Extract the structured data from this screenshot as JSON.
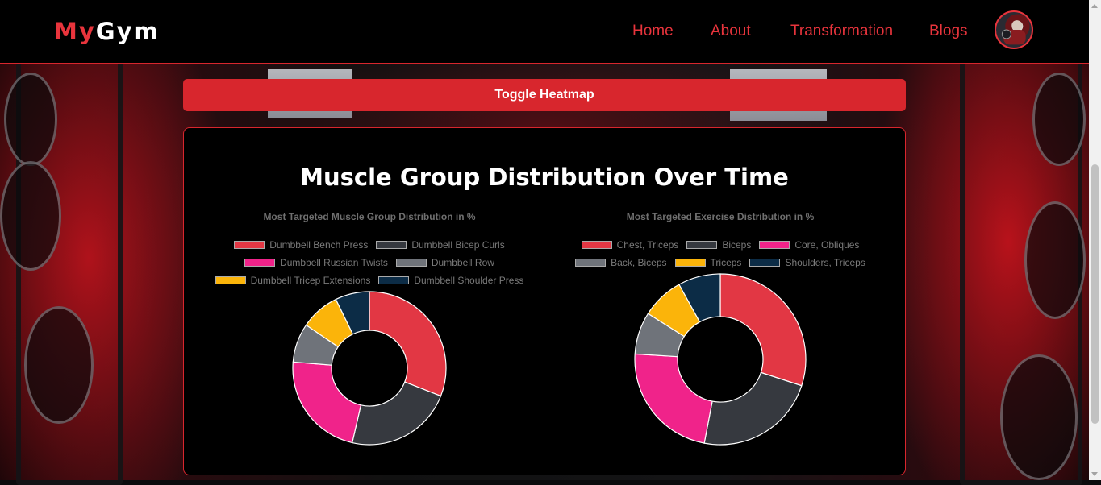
{
  "header": {
    "logo_my": "My",
    "logo_gym": "Gym",
    "nav": [
      "Home",
      "About",
      "Transformation",
      "Blogs"
    ]
  },
  "toggle_label": "Toggle Heatmap",
  "panel_title": "Muscle Group Distribution Over Time",
  "colors": [
    "#e23744",
    "#36393f",
    "#f0238a",
    "#6f737a",
    "#fbb40a",
    "#0c2c46"
  ],
  "chart_data": [
    {
      "type": "donut",
      "title": "Most Targeted Muscle Group Distribution in %",
      "labels": [
        "Dumbbell Bench Press",
        "Dumbbell Bicep Curls",
        "Dumbbell Russian Twists",
        "Dumbbell Row",
        "Dumbbell Tricep Extensions",
        "Dumbbell Shoulder Press"
      ],
      "legend_rows": [
        [
          0,
          1
        ],
        [
          2,
          3
        ],
        [
          4,
          5
        ]
      ],
      "values": [
        30,
        22,
        22,
        8,
        8,
        7
      ],
      "legend": "top"
    },
    {
      "type": "donut",
      "title": "Most Targeted Exercise Distribution in %",
      "labels": [
        "Chest, Triceps",
        "Biceps",
        "Core, Obliques",
        "Back, Biceps",
        "Triceps",
        "Shoulders, Triceps"
      ],
      "legend_rows": [
        [
          0,
          1,
          2
        ],
        [
          3,
          4,
          5
        ]
      ],
      "values": [
        30,
        23,
        23,
        8,
        8,
        8
      ],
      "legend": "top"
    }
  ]
}
